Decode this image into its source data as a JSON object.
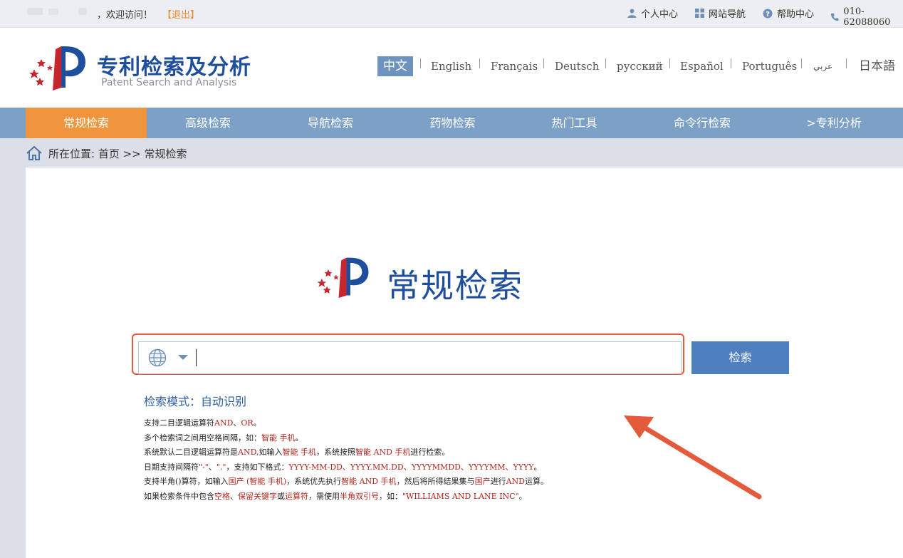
{
  "topbar": {
    "welcome": "，欢迎访问！",
    "logout": "【退出】",
    "links": [
      {
        "label": "个人中心",
        "icon": "user-icon"
      },
      {
        "label": "网站导航",
        "icon": "grid-icon"
      },
      {
        "label": "帮助中心",
        "icon": "question-icon"
      },
      {
        "label": "010-62088060",
        "icon": "phone-icon"
      }
    ]
  },
  "header": {
    "title": "专利检索及分析",
    "subtitle": "Patent Search and Analysis",
    "languages": [
      "中文",
      "English",
      "Français",
      "Deutsch",
      "русский",
      "Español",
      "Português",
      "عربي",
      "日本語"
    ],
    "active_language": "中文"
  },
  "mainnav": {
    "items": [
      "常规检索",
      "高级检索",
      "导航检索",
      "药物检索",
      "热门工具",
      "命令行检索",
      ">专利分析"
    ],
    "active": "常规检索"
  },
  "breadcrumb": {
    "text": "所在位置: 首页 >> 常规检索"
  },
  "main": {
    "title": "常规检索",
    "search": {
      "value": "",
      "placeholder": "",
      "button_label": "检索"
    },
    "mode_label": "检索模式：自动识别",
    "help_lines": [
      [
        {
          "t": "支持二目逻辑运算符"
        },
        {
          "t": "AND",
          "r": true
        },
        {
          "t": "、"
        },
        {
          "t": "OR",
          "r": true
        },
        {
          "t": "。"
        }
      ],
      [
        {
          "t": "多个检索词之间用空格间隔，如："
        },
        {
          "t": "智能 手机",
          "r": true
        },
        {
          "t": "。"
        }
      ],
      [
        {
          "t": "系统默认二目逻辑运算符是"
        },
        {
          "t": "AND",
          "r": true
        },
        {
          "t": ",如输入"
        },
        {
          "t": "智能 手机",
          "r": true
        },
        {
          "t": "，系统按照"
        },
        {
          "t": "智能 AND 手机",
          "r": true
        },
        {
          "t": "进行检索。"
        }
      ],
      [
        {
          "t": "日期支持间隔符"
        },
        {
          "t": "\"-\"",
          "r": true
        },
        {
          "t": "、"
        },
        {
          "t": "\".\"",
          "r": true
        },
        {
          "t": "，支持如下格式："
        },
        {
          "t": "YYYY-MM-DD、YYYY.MM.DD、YYYYMMDD、YYYYMM、YYYY",
          "r": true
        },
        {
          "t": "。"
        }
      ],
      [
        {
          "t": "支持半角()算符，如输入"
        },
        {
          "t": "国产 (智能 手机)",
          "r": true
        },
        {
          "t": "，系统优先执行"
        },
        {
          "t": "智能 AND 手机",
          "r": true
        },
        {
          "t": "，然后将所得结果集与"
        },
        {
          "t": "国产",
          "r": true
        },
        {
          "t": "进行"
        },
        {
          "t": "AND",
          "r": true
        },
        {
          "t": "运算。"
        }
      ],
      [
        {
          "t": "如果检索条件中包含"
        },
        {
          "t": "空格",
          "r": true
        },
        {
          "t": "、"
        },
        {
          "t": "保留关键字",
          "r": true
        },
        {
          "t": "或"
        },
        {
          "t": "运算符",
          "r": true
        },
        {
          "t": "，需使用"
        },
        {
          "t": "半角双引号",
          "r": true
        },
        {
          "t": "，如："
        },
        {
          "t": "\"WILLIAMS AND LANE INC\"",
          "r": true
        },
        {
          "t": "。"
        }
      ]
    ]
  },
  "colors": {
    "nav_bg": "#7da0c6",
    "nav_active": "#f0953e",
    "brand_blue": "#1f4f9c",
    "search_button": "#4e80bf",
    "highlight_red": "#b3261e",
    "annotation_orange": "#e35b3a"
  }
}
